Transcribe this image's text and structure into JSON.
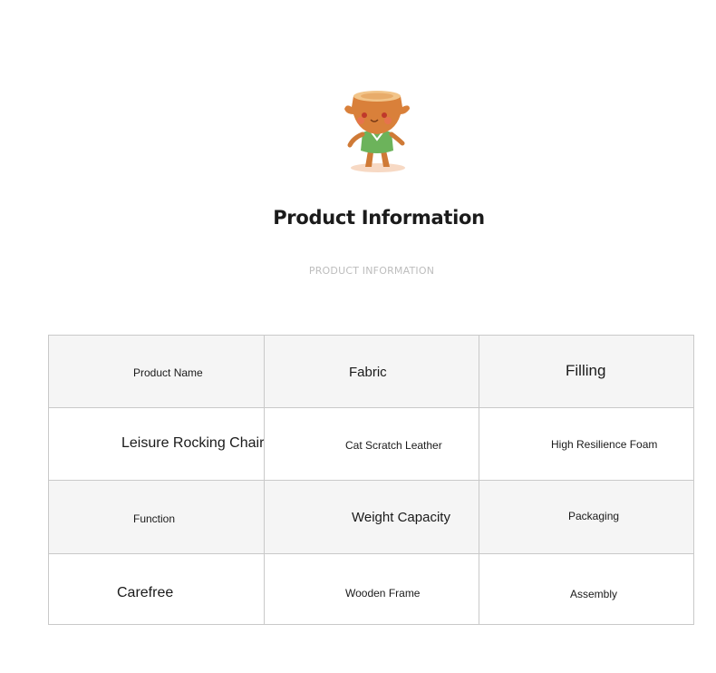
{
  "header": {
    "title": "Product Information",
    "subtitle": "PRODUCT INFORMATION"
  },
  "table": {
    "rows": [
      [
        "Product Name",
        "Fabric",
        "Filling"
      ],
      [
        "Leisure Rocking Chair",
        "Cat Scratch Leather",
        "High Resilience Foam"
      ],
      [
        "Function",
        "Weight Capacity",
        "Packaging"
      ],
      [
        "Carefree",
        "Wooden Frame",
        "Assembly"
      ]
    ]
  },
  "colors": {
    "border": "#c9c9c9",
    "header_row_bg": "#f5f5f5",
    "subtitle": "#bdbdbd",
    "mascot_body": "#d9803a",
    "mascot_shirt": "#6cb35b"
  }
}
